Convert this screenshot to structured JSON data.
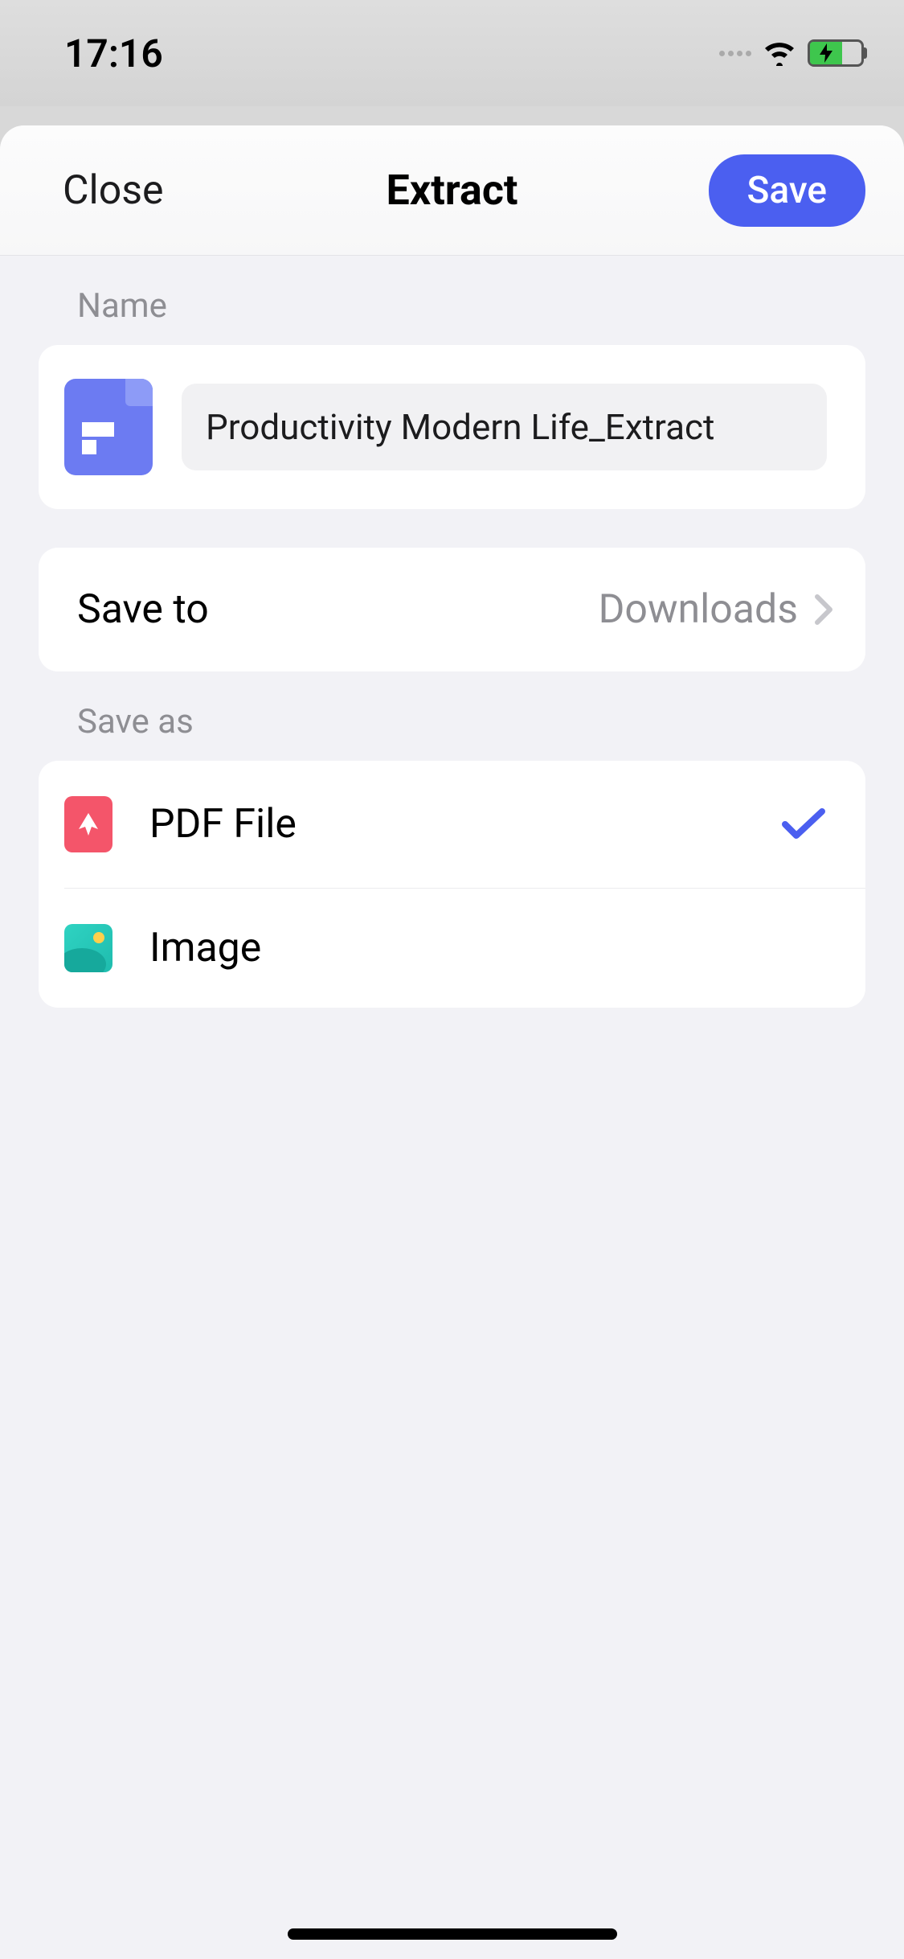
{
  "status": {
    "time": "17:16"
  },
  "header": {
    "close_label": "Close",
    "title": "Extract",
    "save_label": "Save"
  },
  "name_section": {
    "label": "Name",
    "value": "Productivity Modern Life_Extract"
  },
  "save_to": {
    "label": "Save to",
    "value": "Downloads"
  },
  "save_as": {
    "label": "Save as",
    "options": [
      {
        "label": "PDF File",
        "selected": true
      },
      {
        "label": "Image",
        "selected": false
      }
    ]
  }
}
